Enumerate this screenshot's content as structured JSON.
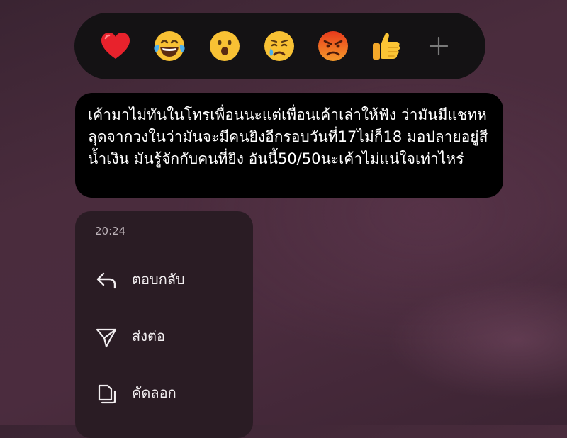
{
  "reactions": {
    "items": [
      {
        "name": "heart",
        "icon": "red-heart-icon"
      },
      {
        "name": "tears-of-joy",
        "icon": "laughing-tears-icon"
      },
      {
        "name": "surprised",
        "icon": "open-mouth-icon"
      },
      {
        "name": "sad",
        "icon": "crying-face-icon"
      },
      {
        "name": "angry",
        "icon": "angry-face-icon"
      },
      {
        "name": "thumbs-up",
        "icon": "thumbs-up-icon"
      }
    ],
    "add_icon": "plus-icon"
  },
  "message": {
    "text": "เค้ามาไม่ทันในโทรเพื่อนนะแต่เพื่อนเค้าเล่าให้ฟัง ว่ามันมีแชทหลุดจากวงในว่ามันจะมีคนยิงอีกรอบวันที่17ไม่ก็18 มอปลายอยู่สีน้ำเงิน มันรู้จักกับคนที่ยิง อันนี้50/50นะเค้าไม่แน่ใจเท่าไหร่"
  },
  "menu": {
    "time": "20:24",
    "items": [
      {
        "label": "ตอบกลับ",
        "icon": "reply-arrow-icon"
      },
      {
        "label": "ส่งต่อ",
        "icon": "send-paper-plane-icon"
      },
      {
        "label": "คัดลอก",
        "icon": "copy-icon"
      }
    ]
  },
  "colors": {
    "background": "#432a39",
    "reaction_bar": "#141214",
    "bubble": "#000000",
    "menu": "#2a1c24",
    "text": "#ffffff"
  }
}
